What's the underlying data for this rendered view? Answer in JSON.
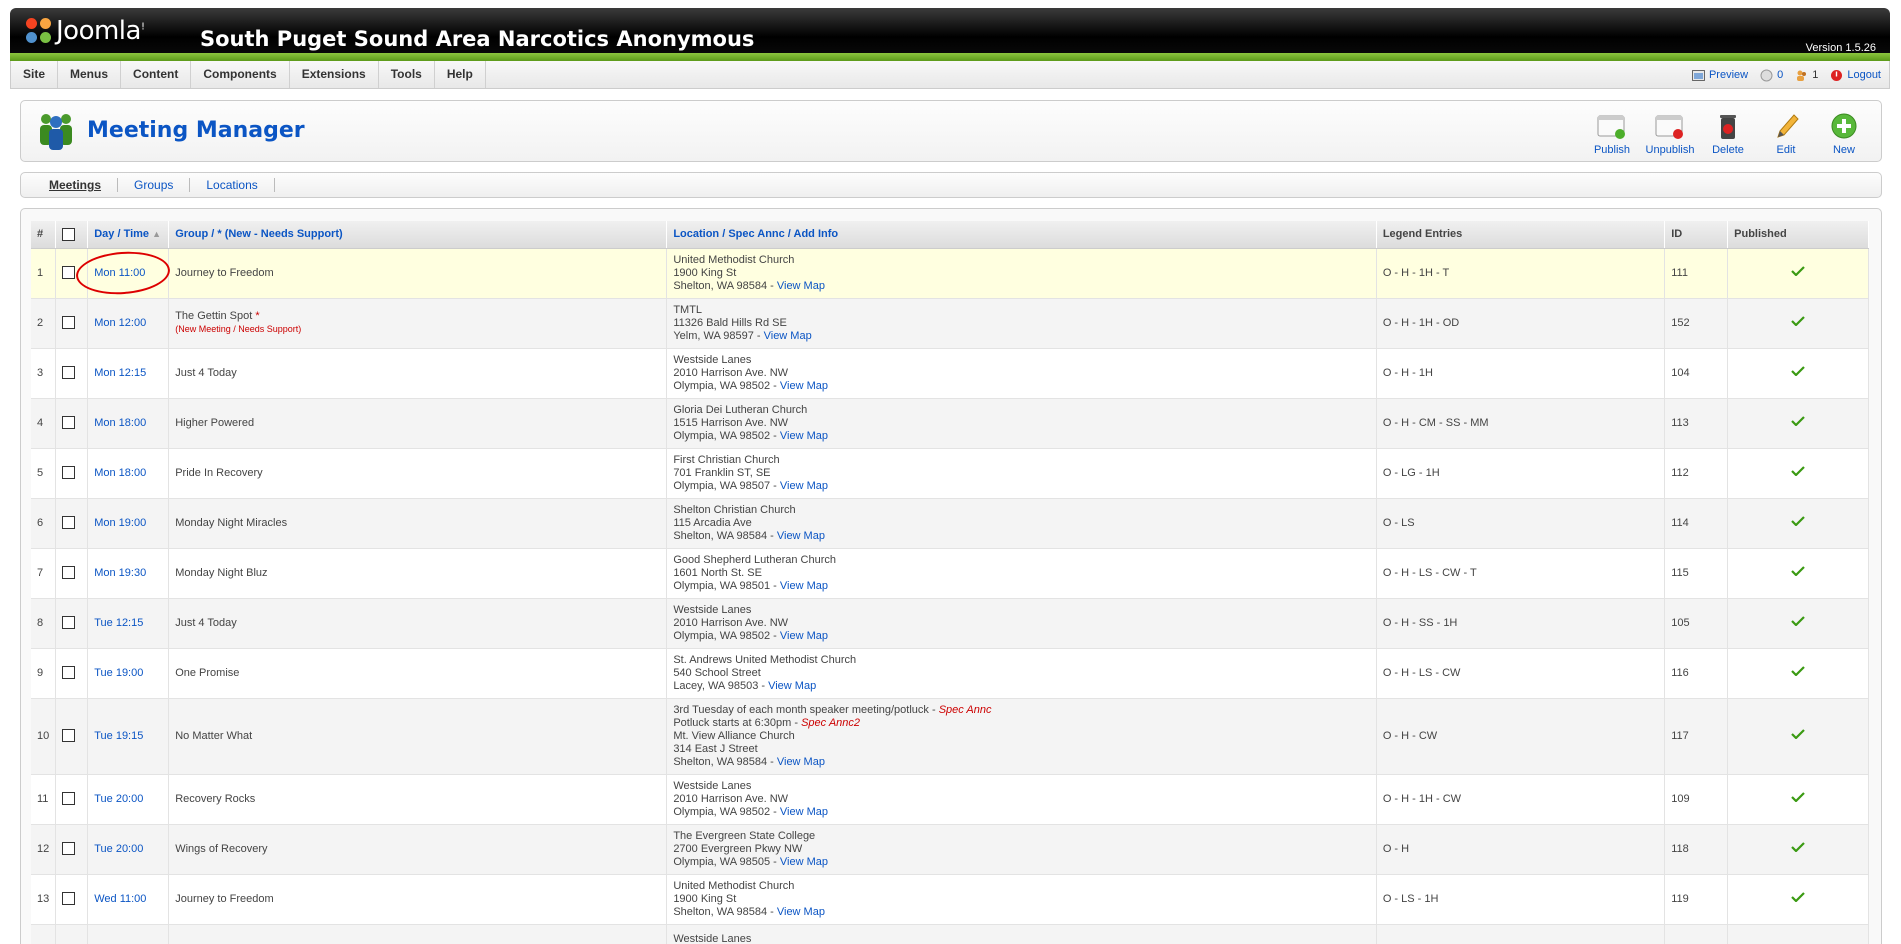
{
  "header": {
    "brand": "Joomla!",
    "site_title": "South Puget Sound Area Narcotics Anonymous",
    "version": "Version 1.5.26"
  },
  "menu": [
    {
      "label": "Site"
    },
    {
      "label": "Menus"
    },
    {
      "label": "Content"
    },
    {
      "label": "Components"
    },
    {
      "label": "Extensions"
    },
    {
      "label": "Tools"
    },
    {
      "label": "Help"
    }
  ],
  "status": {
    "preview": "Preview",
    "messages": "0",
    "users": "1",
    "logout": "Logout"
  },
  "page": {
    "title": "Meeting Manager"
  },
  "toolbar": {
    "publish": "Publish",
    "unpublish": "Unpublish",
    "delete": "Delete",
    "edit": "Edit",
    "new": "New"
  },
  "submenu": {
    "meetings": "Meetings",
    "groups": "Groups",
    "locations": "Locations"
  },
  "table": {
    "headers": {
      "num": "#",
      "day_time": "Day / Time",
      "group": "Group / * (New - Needs Support)",
      "location": "Location / Spec Annc / Add Info",
      "legend": "Legend Entries",
      "id": "ID",
      "published": "Published"
    },
    "rows": [
      {
        "num": "1",
        "time": "Mon 11:00",
        "group": "Journey to Freedom",
        "loc1": "United Methodist Church",
        "loc2": "1900 King St",
        "loc3": "Shelton, WA 98584 - ",
        "map": "View Map",
        "legend": "O - H - 1H - T",
        "id": "111"
      },
      {
        "num": "2",
        "time": "Mon 12:00",
        "group": "The Gettin Spot ",
        "asterisk": "*",
        "needs": "(New Meeting / Needs Support)",
        "loc1": "TMTL",
        "loc2": "11326 Bald Hills Rd SE",
        "loc3": "Yelm, WA 98597 - ",
        "map": "View Map",
        "legend": "O - H - 1H - OD",
        "id": "152"
      },
      {
        "num": "3",
        "time": "Mon 12:15",
        "group": "Just 4 Today",
        "loc1": "Westside Lanes",
        "loc2": "2010 Harrison Ave. NW",
        "loc3": "Olympia, WA 98502 - ",
        "map": "View Map",
        "legend": "O - H - 1H",
        "id": "104"
      },
      {
        "num": "4",
        "time": "Mon 18:00",
        "group": "Higher Powered",
        "loc1": "Gloria Dei Lutheran Church",
        "loc2": "1515 Harrison Ave. NW",
        "loc3": "Olympia, WA 98502 - ",
        "map": "View Map",
        "legend": "O - H - CM - SS - MM",
        "id": "113"
      },
      {
        "num": "5",
        "time": "Mon 18:00",
        "group": "Pride In Recovery",
        "loc1": "First Christian Church",
        "loc2": "701 Franklin ST, SE",
        "loc3": "Olympia, WA 98507 - ",
        "map": "View Map",
        "legend": "O - LG - 1H",
        "id": "112"
      },
      {
        "num": "6",
        "time": "Mon 19:00",
        "group": "Monday Night Miracles",
        "loc1": "Shelton Christian Church",
        "loc2": "115 Arcadia Ave",
        "loc3": "Shelton, WA 98584 - ",
        "map": "View Map",
        "legend": "O - LS",
        "id": "114"
      },
      {
        "num": "7",
        "time": "Mon 19:30",
        "group": "Monday Night Bluz",
        "loc1": "Good Shepherd Lutheran Church",
        "loc2": "1601 North St. SE",
        "loc3": "Olympia, WA 98501 - ",
        "map": "View Map",
        "legend": "O - H - LS - CW - T",
        "id": "115"
      },
      {
        "num": "8",
        "time": "Tue 12:15",
        "group": "Just 4 Today",
        "loc1": "Westside Lanes",
        "loc2": "2010 Harrison Ave. NW",
        "loc3": "Olympia, WA 98502 - ",
        "map": "View Map",
        "legend": "O - H - SS - 1H",
        "id": "105"
      },
      {
        "num": "9",
        "time": "Tue 19:00",
        "group": "One Promise",
        "loc1": "St. Andrews United Methodist Church",
        "loc2": "540 School Street",
        "loc3": "Lacey, WA 98503 - ",
        "map": "View Map",
        "legend": "O - H - LS - CW",
        "id": "116"
      },
      {
        "num": "10",
        "time": "Tue 19:15",
        "group": "No Matter What",
        "spec1_text": "3rd Tuesday of each month speaker meeting/potluck - ",
        "spec1": "Spec Annc",
        "spec2_text": "Potluck starts at 6:30pm - ",
        "spec2": "Spec Annc2",
        "loc1": "Mt. View Alliance Church",
        "loc2": "314 East J Street",
        "loc3": "Shelton, WA 98584 - ",
        "map": "View Map",
        "legend": "O - H - CW",
        "id": "117"
      },
      {
        "num": "11",
        "time": "Tue 20:00",
        "group": "Recovery Rocks",
        "loc1": "Westside Lanes",
        "loc2": "2010 Harrison Ave. NW",
        "loc3": "Olympia, WA 98502 - ",
        "map": "View Map",
        "legend": "O - H - 1H - CW",
        "id": "109"
      },
      {
        "num": "12",
        "time": "Tue 20:00",
        "group": "Wings of Recovery",
        "loc1": "The Evergreen State College",
        "loc2": "2700 Evergreen Pkwy NW",
        "loc3": "Olympia, WA 98505 - ",
        "map": "View Map",
        "legend": "O - H",
        "id": "118"
      },
      {
        "num": "13",
        "time": "Wed 11:00",
        "group": "Journey to Freedom",
        "loc1": "United Methodist Church",
        "loc2": "1900 King St",
        "loc3": "Shelton, WA 98584 - ",
        "map": "View Map",
        "legend": "O - LS - 1H",
        "id": "119"
      },
      {
        "num": "",
        "time": "",
        "group": "",
        "loc1": "Westside Lanes",
        "loc2": "",
        "loc3": "",
        "map": "",
        "legend": "",
        "id": ""
      }
    ]
  },
  "colors": {
    "link": "#0b55c4",
    "header_green": "#8cc63e",
    "highlight_row": "#ffffe0",
    "annotation_red": "#dd0000",
    "check_green": "#3a9a12"
  }
}
